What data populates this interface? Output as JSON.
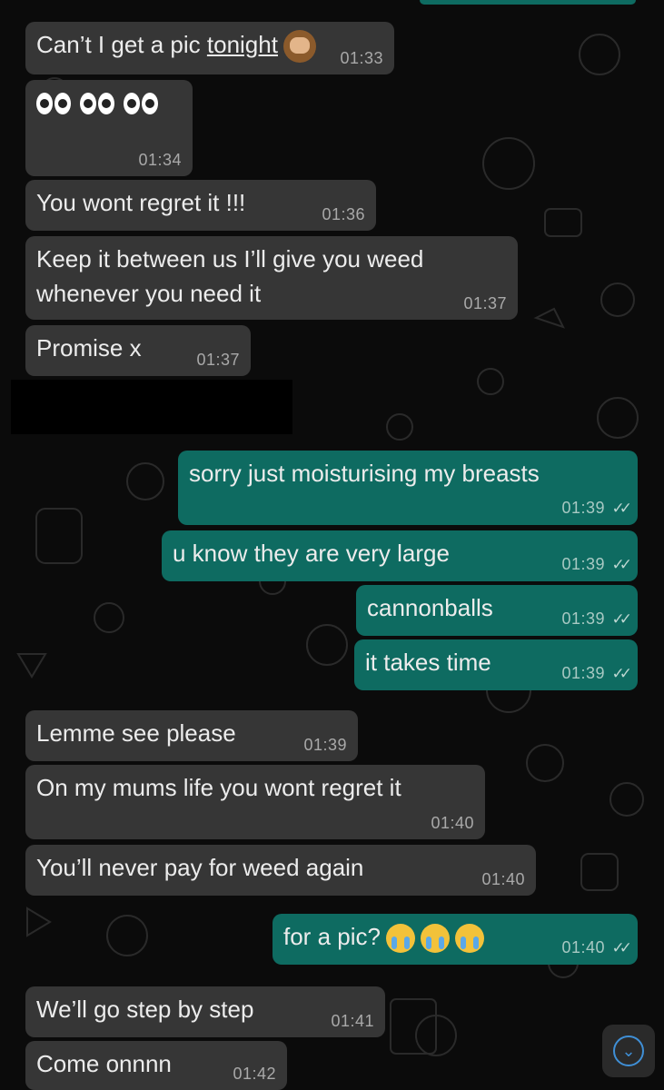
{
  "colors": {
    "incoming": "#363636",
    "outgoing": "#0e6b61",
    "background": "#0b0b0b",
    "scroll_accent": "#3f8fd6"
  },
  "messages": [
    {
      "dir": "in",
      "text": "Can’t I get a pic ",
      "link": "tonight",
      "emoji": "see-no-evil-monkey",
      "time": "01:33"
    },
    {
      "dir": "in",
      "emoji": "eyes-x3",
      "time": "01:34"
    },
    {
      "dir": "in",
      "text": "You wont regret it !!!",
      "time": "01:36"
    },
    {
      "dir": "in",
      "text": "Keep it between us I’ll give you weed\nwhenever you need it",
      "time": "01:37"
    },
    {
      "dir": "in",
      "text": "Promise x",
      "time": "01:37"
    },
    {
      "dir": "out",
      "text": "sorry just moisturising my breasts",
      "time": "01:39",
      "status": "read"
    },
    {
      "dir": "out",
      "text": "u know they are very large",
      "time": "01:39",
      "status": "read"
    },
    {
      "dir": "out",
      "text": "cannonballs",
      "time": "01:39",
      "status": "read"
    },
    {
      "dir": "out",
      "text": "it takes time",
      "time": "01:39",
      "status": "read"
    },
    {
      "dir": "in",
      "text": "Lemme see please",
      "time": "01:39"
    },
    {
      "dir": "in",
      "text": "On my mums life you wont regret it",
      "time": "01:40"
    },
    {
      "dir": "in",
      "text": "You’ll never pay for weed again",
      "time": "01:40"
    },
    {
      "dir": "out",
      "text": "for a pic?",
      "emoji": "loudly-crying-x3",
      "time": "01:40",
      "status": "read"
    },
    {
      "dir": "in",
      "text": "We’ll go step by step",
      "time": "01:41"
    },
    {
      "dir": "in",
      "text": "Come onnnn",
      "time": "01:42"
    }
  ],
  "ticks": "✓✓",
  "scroll_down_icon": "chevron-down-icon"
}
